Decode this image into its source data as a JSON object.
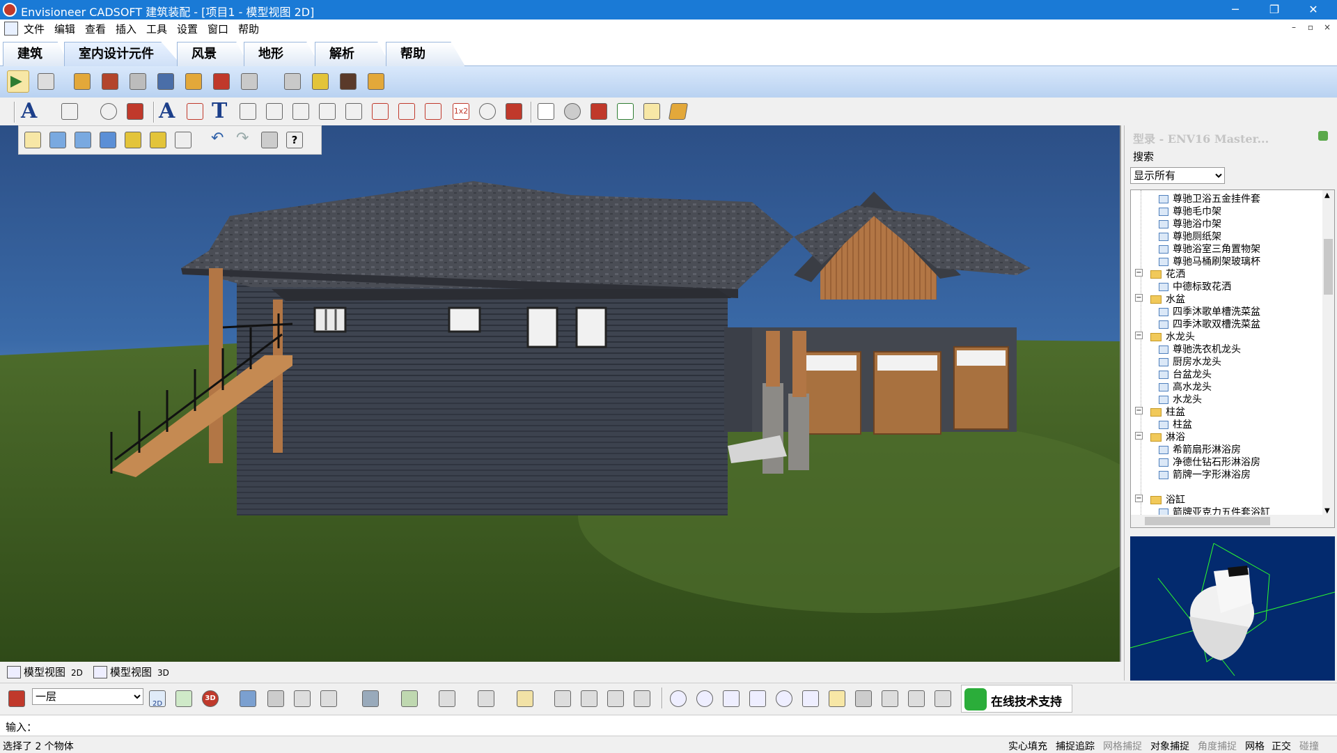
{
  "window": {
    "title": "Envisioneer CADSOFT 建筑装配 - [项目1 - 模型视图 2D]",
    "controls": [
      "─",
      "❐",
      "✕"
    ]
  },
  "menu": {
    "items": [
      "文件",
      "编辑",
      "查看",
      "插入",
      "工具",
      "设置",
      "窗口",
      "帮助"
    ],
    "mdi_controls": [
      "–",
      "▫",
      "×"
    ]
  },
  "ribbon": {
    "tabs": [
      "建筑",
      "室内设计元件",
      "风景",
      "地形",
      "解析",
      "帮助"
    ],
    "active_tab": "室内设计元件"
  },
  "library": {
    "title": "型录 - ENV16 Master...",
    "search_label": "搜索",
    "filter_value": "显示所有",
    "tree": [
      {
        "label": "尊驰卫浴五金挂件套",
        "type": "leaf"
      },
      {
        "label": "尊驰毛巾架",
        "type": "leaf"
      },
      {
        "label": "尊驰浴巾架",
        "type": "leaf"
      },
      {
        "label": "尊驰厕纸架",
        "type": "leaf"
      },
      {
        "label": "尊驰浴室三角置物架",
        "type": "leaf"
      },
      {
        "label": "尊驰马桶刷架玻璃杯",
        "type": "leaf"
      },
      {
        "label": "花洒",
        "type": "folder"
      },
      {
        "label": "中德标致花洒",
        "type": "leaf"
      },
      {
        "label": "水盆",
        "type": "folder"
      },
      {
        "label": "四季沐歌单槽洗菜盆",
        "type": "leaf"
      },
      {
        "label": "四季沐歌双槽洗菜盆",
        "type": "leaf"
      },
      {
        "label": "水龙头",
        "type": "folder"
      },
      {
        "label": "尊驰洗衣机龙头",
        "type": "leaf"
      },
      {
        "label": "厨房水龙头",
        "type": "leaf"
      },
      {
        "label": "台盆龙头",
        "type": "leaf"
      },
      {
        "label": "高水龙头",
        "type": "leaf"
      },
      {
        "label": "水龙头",
        "type": "leaf"
      },
      {
        "label": "柱盆",
        "type": "folder"
      },
      {
        "label": "柱盆",
        "type": "leaf"
      },
      {
        "label": "淋浴",
        "type": "folder"
      },
      {
        "label": "希箭扇形淋浴房",
        "type": "leaf"
      },
      {
        "label": "净德仕钻石形淋浴房",
        "type": "leaf"
      },
      {
        "label": "箭牌一字形淋浴房",
        "type": "leaf"
      },
      {
        "label": "",
        "type": "gap"
      },
      {
        "label": "浴缸",
        "type": "folder"
      },
      {
        "label": "箭牌亚克力五件套浴缸",
        "type": "leaf"
      }
    ]
  },
  "view_tabs": [
    {
      "label": "模型视图",
      "badge": "2D"
    },
    {
      "label": "模型视图",
      "badge": "3D"
    }
  ],
  "toolbar3": {
    "view_2d": "2D",
    "view_2d3d": "2D",
    "view_3d": "3D",
    "dim_badge": "1x2"
  },
  "bottom": {
    "level": "一层",
    "support_label": "在线技术支持"
  },
  "command": {
    "label": "输入："
  },
  "status": {
    "selection": "选择了 2 个物体",
    "snaps": [
      {
        "label": "实心填充",
        "on": true
      },
      {
        "label": "捕捉追踪",
        "on": true
      },
      {
        "label": "网格捕捉",
        "on": false
      },
      {
        "label": "对象捕捉",
        "on": true
      },
      {
        "label": "角度捕捉",
        "on": false
      },
      {
        "label": "网格",
        "on": true
      },
      {
        "label": "正交",
        "on": true
      },
      {
        "label": "碰撞",
        "on": false
      }
    ]
  },
  "colors": {
    "titlebar": "#1a7ad6",
    "sky": "#3a6aa8",
    "grass": "#3f5e23",
    "siding": "#3e4450",
    "roof": "#4a4d55",
    "preview_bg": "#032a6e"
  }
}
